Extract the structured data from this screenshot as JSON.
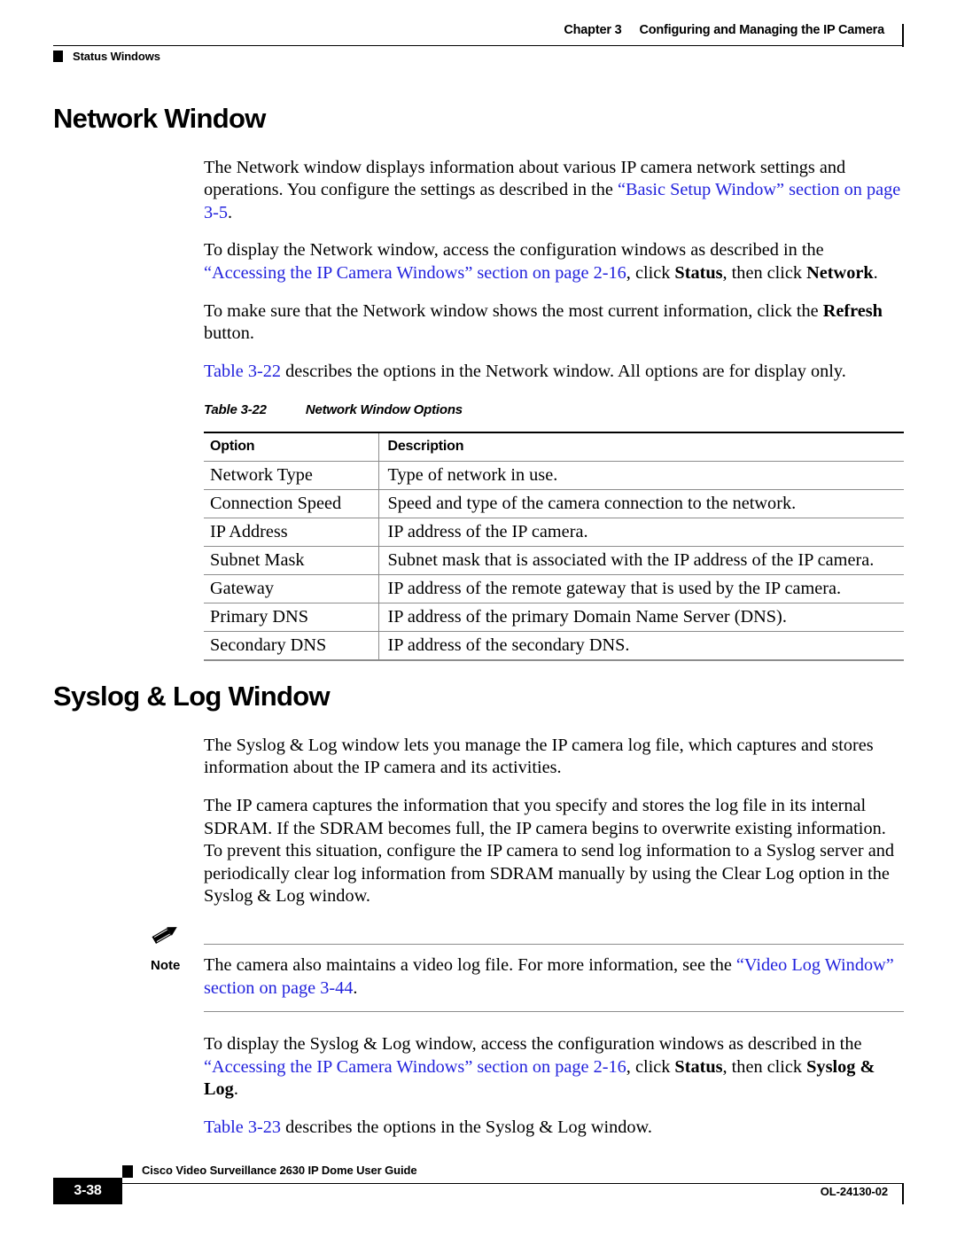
{
  "header": {
    "chapter_label": "Chapter 3",
    "chapter_title": "Configuring and Managing the IP Camera",
    "section_marker_icon": "black-square-marker",
    "section_label": "Status Windows"
  },
  "sections": [
    {
      "title": "Network Window",
      "paragraphs": [
        {
          "runs": [
            {
              "text": "The Network window displays information about various IP camera network settings and operations. You configure the settings as described in the ",
              "style": "normal"
            },
            {
              "text": "“Basic Setup Window” section on page 3-5",
              "style": "link"
            },
            {
              "text": ".",
              "style": "normal"
            }
          ]
        },
        {
          "runs": [
            {
              "text": "To display the Network window, access the configuration windows as described in the ",
              "style": "normal"
            },
            {
              "text": "“Accessing the IP Camera Windows” section on page 2-16",
              "style": "link"
            },
            {
              "text": ", click ",
              "style": "normal"
            },
            {
              "text": "Status",
              "style": "bold"
            },
            {
              "text": ", then click ",
              "style": "normal"
            },
            {
              "text": "Network",
              "style": "bold"
            },
            {
              "text": ".",
              "style": "normal"
            }
          ]
        },
        {
          "runs": [
            {
              "text": "To make sure that the Network window shows the most current information, click the ",
              "style": "normal"
            },
            {
              "text": "Refresh",
              "style": "bold"
            },
            {
              "text": " button.",
              "style": "normal"
            }
          ]
        },
        {
          "runs": [
            {
              "text": "Table 3-22",
              "style": "link"
            },
            {
              "text": " describes the options in the Network window. All options are for display only.",
              "style": "normal"
            }
          ]
        }
      ]
    }
  ],
  "table": {
    "caption_number": "Table 3-22",
    "caption_title": "Network Window Options",
    "columns": [
      "Option",
      "Description"
    ],
    "rows": [
      [
        "Network Type",
        "Type of network in use."
      ],
      [
        "Connection Speed",
        "Speed and type of the camera connection to the network."
      ],
      [
        "IP Address",
        "IP address of the IP camera."
      ],
      [
        "Subnet Mask",
        "Subnet mask that is associated with the IP address of the IP camera."
      ],
      [
        "Gateway",
        "IP address of the remote gateway that is used by the IP camera."
      ],
      [
        "Primary DNS",
        "IP address of the primary Domain Name Server (DNS)."
      ],
      [
        "Secondary DNS",
        "IP address of the secondary DNS."
      ]
    ]
  },
  "section2": {
    "title": "Syslog & Log Window",
    "paragraphs": [
      {
        "runs": [
          {
            "text": "The Syslog & Log window lets you manage the IP camera log file, which captures and stores information about the IP camera and its activities.",
            "style": "normal"
          }
        ]
      },
      {
        "runs": [
          {
            "text": "The IP camera captures the information that you specify and stores the log file in its internal SDRAM. If the SDRAM becomes full, the IP camera begins to overwrite existing information. To prevent this situation, configure the IP camera to send log information to a Syslog server and periodically clear log information from SDRAM manually by using the Clear Log option in the Syslog & Log window.",
            "style": "normal"
          }
        ]
      }
    ],
    "note": {
      "icon": "pencil-icon",
      "label": "Note",
      "runs": [
        {
          "text": "The camera also maintains a video log file. For more information, see the ",
          "style": "normal"
        },
        {
          "text": "“Video Log Window” section on page 3-44",
          "style": "link"
        },
        {
          "text": ".",
          "style": "normal"
        }
      ]
    },
    "paragraphs_after": [
      {
        "runs": [
          {
            "text": "To display the Syslog & Log window, access the configuration windows as described in the ",
            "style": "normal"
          },
          {
            "text": "“Accessing the IP Camera Windows” section on page 2-16",
            "style": "link"
          },
          {
            "text": ", click ",
            "style": "normal"
          },
          {
            "text": "Status",
            "style": "bold"
          },
          {
            "text": ", then click ",
            "style": "normal"
          },
          {
            "text": "Syslog & Log",
            "style": "bold"
          },
          {
            "text": ".",
            "style": "normal"
          }
        ]
      },
      {
        "runs": [
          {
            "text": "Table 3-23",
            "style": "link"
          },
          {
            "text": " describes the options in the Syslog & Log window.",
            "style": "normal"
          }
        ]
      }
    ]
  },
  "footer": {
    "marker_icon": "black-square-marker",
    "guide_title": "Cisco Video Surveillance 2630 IP Dome User Guide",
    "page_number": "3-38",
    "doc_id": "OL-24130-02"
  },
  "colors": {
    "link": "#2222dd",
    "rule": "#8d8d8d",
    "text": "#000000"
  }
}
